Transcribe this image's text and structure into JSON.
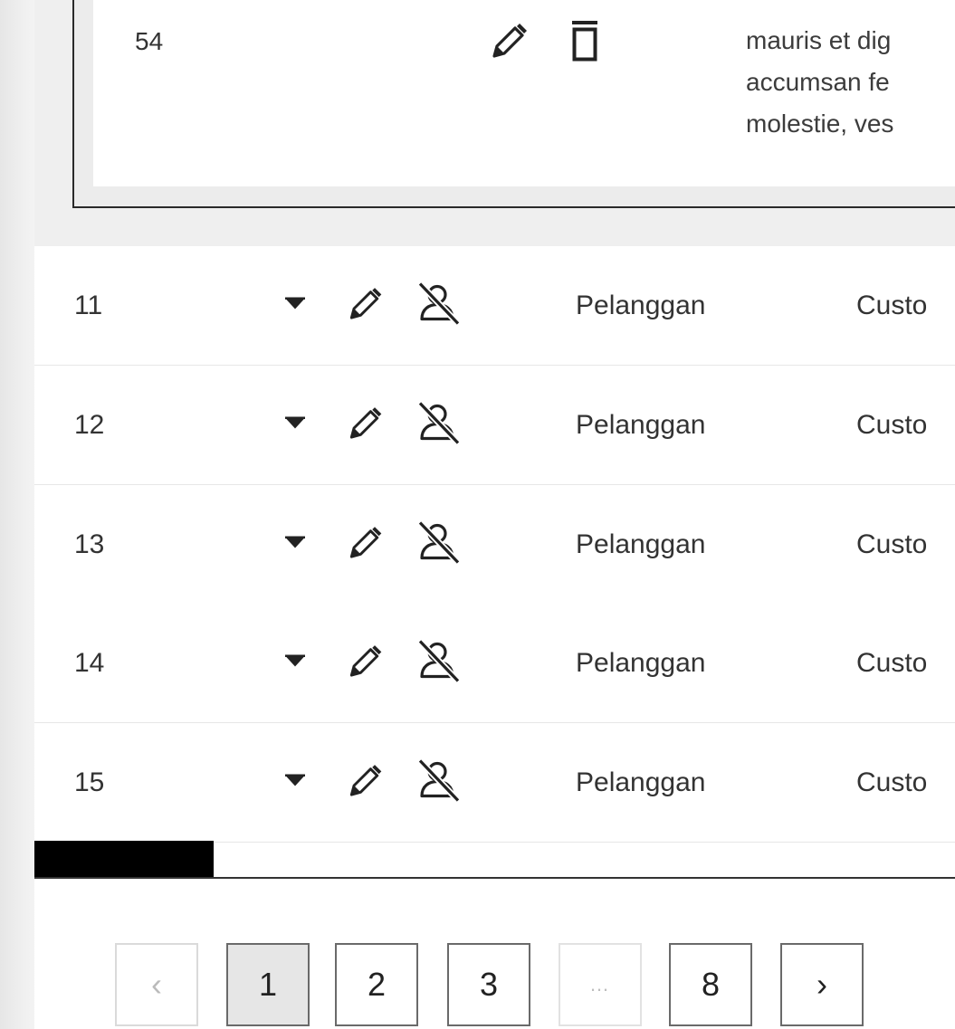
{
  "nested_row": {
    "id": "54",
    "text_lines": [
      "mauris et dig",
      "accumsan fe",
      "molestie, ves"
    ]
  },
  "rows": [
    {
      "id": "11",
      "type": "Pelanggan",
      "category": "Custo"
    },
    {
      "id": "12",
      "type": "Pelanggan",
      "category": "Custo"
    },
    {
      "id": "13",
      "type": "Pelanggan",
      "category": "Custo"
    },
    {
      "id": "14",
      "type": "Pelanggan",
      "category": "Custo"
    },
    {
      "id": "15",
      "type": "Pelanggan",
      "category": "Custo"
    }
  ],
  "pagination": {
    "prev_label": "‹",
    "next_label": "›",
    "pages": [
      "1",
      "2",
      "3"
    ],
    "ellipsis": "…",
    "last_page": "8",
    "current_page": "1"
  },
  "icons": {
    "expand": "caret-down-icon",
    "edit": "pencil-icon",
    "delete": "trash-icon",
    "user": "user-off-icon"
  }
}
